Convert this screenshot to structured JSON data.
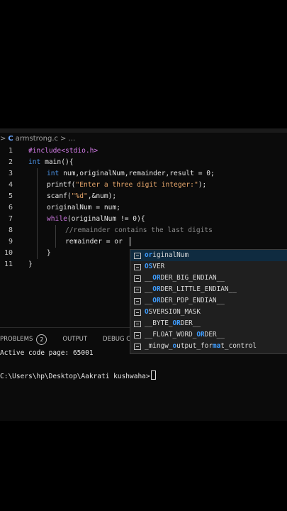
{
  "breadcrumb": {
    "sep": ">",
    "file": "armstrong.c",
    "more": "> ..."
  },
  "code_lines": [
    {
      "no": "1"
    },
    {
      "no": "2"
    },
    {
      "no": "3"
    },
    {
      "no": "4"
    },
    {
      "no": "5"
    },
    {
      "no": "6"
    },
    {
      "no": "7"
    },
    {
      "no": "8"
    },
    {
      "no": "9"
    },
    {
      "no": "10"
    },
    {
      "no": "11"
    }
  ],
  "code": {
    "l1_pp": "#include",
    "l1_rest": "<stdio.h>",
    "l2_kw": "int",
    "l2_rest": " main(){",
    "l3_kw": "int",
    "l3_rest": " num,originalNum,remainder,result = 0;",
    "l4_fn": "printf(",
    "l4_str": "\"Enter a three digit integer:\"",
    "l4_end": ");",
    "l5_fn": "scanf(",
    "l5_str": "\"%d\"",
    "l5_end": ",&num);",
    "l6": "originalNum = num;",
    "l7_kw": "while",
    "l7_rest": "(originalNum != 0){",
    "l8_cm": "//remainder contains the last digits",
    "l9": "remainder = or",
    "l10": "}",
    "l11": "}"
  },
  "panel": {
    "tabs": [
      {
        "label": "PROBLEMS",
        "badge": "2"
      },
      {
        "label": "OUTPUT"
      },
      {
        "label": "DEBUG CO"
      }
    ],
    "terminal_line1": "Active code page: 65001",
    "terminal_prompt": "C:\\Users\\hp\\Desktop\\Aakrati kushwaha>"
  },
  "suggestions": [
    {
      "pre": "",
      "match": "or",
      "post": "iginalNum",
      "selected": true,
      "icon": "variable-icon"
    },
    {
      "pre": "",
      "match": "OS",
      "post": "VER",
      "icon": "constant-icon"
    },
    {
      "pre": "__",
      "match": "OR",
      "post": "DER_BIG_ENDIAN__",
      "icon": "constant-icon"
    },
    {
      "pre": "__",
      "match": "OR",
      "post": "DER_LITTLE_ENDIAN__",
      "icon": "constant-icon"
    },
    {
      "pre": "__",
      "match": "OR",
      "post": "DER_PDP_ENDIAN__",
      "icon": "constant-icon"
    },
    {
      "pre": "",
      "match": "O",
      "post": "SVERSION_MASK",
      "icon": "constant-icon"
    },
    {
      "pre": "__BYTE_",
      "match": "OR",
      "post": "DER__",
      "icon": "constant-icon"
    },
    {
      "pre": "__FLOAT_WORD_",
      "match": "OR",
      "post": "DER__",
      "icon": "constant-icon"
    },
    {
      "pre": "_mingw_",
      "match": "o",
      "post": "utput_for",
      "tail_match": "ma",
      "tail": "t_control",
      "icon": "constant-icon"
    }
  ],
  "colors": {
    "keyword": "#4a90e2",
    "preprocessor": "#d27be6",
    "string": "#e6a66b",
    "comment": "#8a8a8a",
    "match": "#3f9dff"
  }
}
